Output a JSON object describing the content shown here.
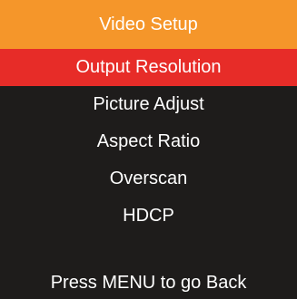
{
  "header": {
    "title": "Video Setup"
  },
  "menu": {
    "selected_index": 0,
    "items": [
      {
        "label": "Output Resolution"
      },
      {
        "label": "Picture Adjust"
      },
      {
        "label": "Aspect Ratio"
      },
      {
        "label": "Overscan"
      },
      {
        "label": "HDCP"
      }
    ]
  },
  "footer": {
    "hint": "Press MENU to go Back"
  },
  "colors": {
    "background": "#1e1c1b",
    "header": "#f5962a",
    "selection": "#e72c28",
    "text": "#ffffff"
  }
}
